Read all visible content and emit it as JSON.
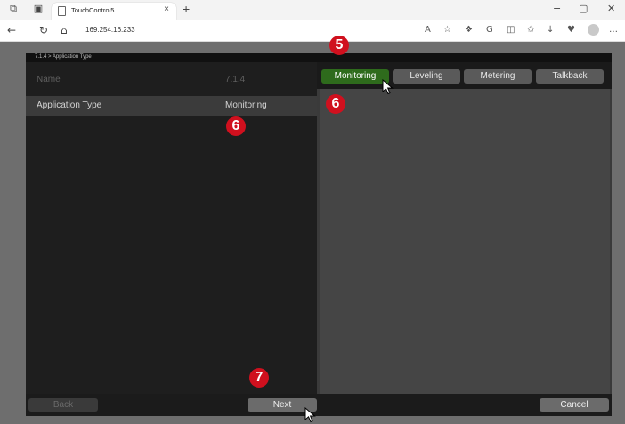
{
  "browser": {
    "tab_title": "TouchControl5",
    "tab_close": "×",
    "new_tab": "+",
    "url": "169.254.16.233",
    "window_controls": {
      "minimize": "−",
      "maximize": "▢",
      "close": "✕"
    },
    "icons": [
      "workspaces-icon",
      "tab-actions-icon",
      "back-icon",
      "refresh-icon",
      "home-icon",
      "read-aloud-icon",
      "favorite-icon",
      "extensions-icon",
      "copilot-icon",
      "split-screen-icon",
      "favorites-bar-icon",
      "downloads-icon",
      "performance-icon",
      "profile-icon",
      "more-icon"
    ]
  },
  "app": {
    "breadcrumb": "7.1.4 > Application Type",
    "rows": [
      {
        "key": "Name",
        "value": "7.1.4"
      },
      {
        "key": "Application Type",
        "value": "Monitoring"
      }
    ],
    "segments": [
      {
        "label": "Monitoring",
        "active": true
      },
      {
        "label": "Leveling",
        "active": false
      },
      {
        "label": "Metering",
        "active": false
      },
      {
        "label": "Talkback",
        "active": false
      }
    ],
    "buttons": {
      "back": "Back",
      "next": "Next",
      "cancel": "Cancel"
    },
    "callouts": [
      "5",
      "6",
      "6",
      "7"
    ],
    "colors": {
      "active_segment": "#2e6b1c",
      "callout": "#d0101e"
    }
  }
}
